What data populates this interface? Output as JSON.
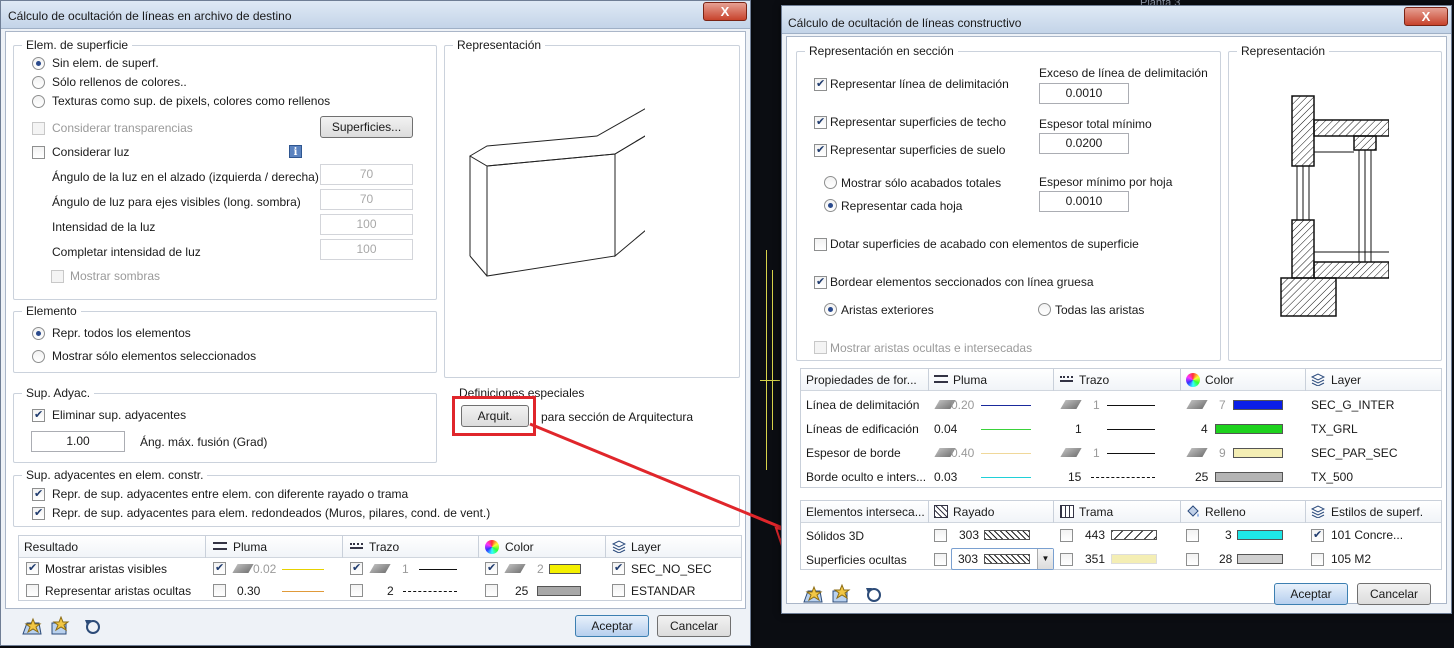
{
  "background": {
    "texts": [
      "Planta 3"
    ],
    "colors": {
      "accent_line": "#d6d24a"
    }
  },
  "left_dialog": {
    "title": "Cálculo de ocultación de líneas en archivo de destino",
    "close_label": "X",
    "surface": {
      "group_title": "Elem. de superficie",
      "radios": [
        {
          "label": "Sin elem. de superf.",
          "checked": true
        },
        {
          "label": "Sólo rellenos de colores..",
          "checked": false
        },
        {
          "label": "Texturas como sup. de pixels, colores como rellenos",
          "checked": false
        }
      ],
      "transparencias": "Considerar transparencias",
      "superficies_btn": "Superficies...",
      "considerar_luz": "Considerar luz",
      "light_rows": [
        {
          "label": "Ángulo de la luz en el alzado (izquierda / derecha)",
          "value": "70"
        },
        {
          "label": "Ángulo de luz para ejes visibles (long. sombra)",
          "value": "70"
        },
        {
          "label": "Intensidad de la luz",
          "value": "100"
        },
        {
          "label": "Completar intensidad de luz",
          "value": "100"
        }
      ],
      "sombras": "Mostrar sombras"
    },
    "representacion_title": "Representación",
    "elemento": {
      "group_title": "Elemento",
      "radios": [
        {
          "label": "Repr. todos los elementos",
          "checked": true
        },
        {
          "label": "Mostrar sólo elementos seleccionados",
          "checked": false
        }
      ]
    },
    "sup_adyac": {
      "group_title": "Sup. Adyac.",
      "eliminar": "Eliminar sup. adyacentes",
      "value": "1.00",
      "angle_label": "Áng. máx. fusión (Grad)"
    },
    "definiciones": {
      "group_title": "Definiciones especiales",
      "arquit_btn": "Arquit.",
      "arquit_desc": "para sección de Arquitectura"
    },
    "sup_constr": {
      "group_title": "Sup. adyacentes en elem. constr.",
      "opt1": "Repr. de sup. adyacentes entre elem. con diferente rayado o trama",
      "opt2": "Repr. de sup. adyacentes para elem. redondeados (Muros, pilares, cond. de vent.)"
    },
    "result_table": {
      "headers": [
        "Resultado",
        "Pluma",
        "Trazo",
        "Color",
        "Layer"
      ],
      "rows": [
        {
          "label": "Mostrar aristas visibles",
          "pluma": "0.02",
          "trazo": "1",
          "color": "2",
          "layer": "SEC_NO_SEC",
          "color_hex": "#f4f000",
          "pen_line": "#e6d100"
        },
        {
          "label": "Representar aristas ocultas",
          "pluma": "0.30",
          "trazo": "2",
          "color": "25",
          "layer": "ESTANDAR",
          "color_hex": "#a8a8a8",
          "pen_line": "#e09a3a"
        }
      ]
    },
    "footer": {
      "aceptar": "Aceptar",
      "cancelar": "Cancelar"
    }
  },
  "right_dialog": {
    "title": "Cálculo de ocultación de líneas constructivo",
    "close_label": "X",
    "seccion": {
      "group_title": "Representación en sección",
      "linea_delim": "Representar línea de delimitación",
      "exceso_label": "Exceso de línea de delimitación",
      "exceso_value": "0.0010",
      "techo": "Representar superficies de techo",
      "espesor_total_label": "Espesor total mínimo",
      "espesor_total_value": "0.0200",
      "suelo": "Representar superficies de suelo",
      "acabados": "Mostrar sólo acabados totales",
      "espesor_hoja_label": "Espesor mínimo por hoja",
      "cada_hoja": "Representar cada hoja",
      "espesor_hoja_value": "0.0010",
      "dotar": "Dotar superficies de acabado con elementos de superficie",
      "bordear": "Bordear elementos seccionados con línea gruesa",
      "aristas_ext": "Aristas exteriores",
      "todas_aristas": "Todas las aristas",
      "ocultas": "Mostrar aristas ocultas e intersecadas"
    },
    "representacion_title": "Representación",
    "props_table": {
      "headers": [
        "Propiedades de for...",
        "Pluma",
        "Trazo",
        "Color",
        "Layer"
      ],
      "rows": [
        {
          "label": "Línea de delimitación",
          "pluma": "0.20",
          "trazo": "1",
          "color": "7",
          "layer": "SEC_G_INTER",
          "color_hex": "#0a1ee6",
          "pen_line": "#1a2a9c",
          "inherit": true
        },
        {
          "label": "Líneas de edificación",
          "pluma": "0.04",
          "trazo": "1",
          "color": "4",
          "layer": "TX_GRL",
          "color_hex": "#1ed21e",
          "pen_line": "#3ad23a",
          "inherit": false
        },
        {
          "label": "Espesor de borde",
          "pluma": "0.40",
          "trazo": "1",
          "color": "9",
          "layer": "SEC_PAR_SEC",
          "color_hex": "#f4eeb4",
          "pen_line": "#f0d89a",
          "inherit": true
        },
        {
          "label": "Borde oculto e inters...",
          "pluma": "0.03",
          "trazo": "15",
          "color": "25",
          "layer": "TX_500",
          "color_hex": "#b4b4b4",
          "pen_line": "#20d0d8",
          "inherit": false
        }
      ]
    },
    "inter_table": {
      "headers": [
        "Elementos interseca...",
        "Rayado",
        "Trama",
        "Relleno",
        "Estilos de superf."
      ],
      "rows": [
        {
          "label": "Sólidos 3D",
          "rayado": "303",
          "trama": "443",
          "relleno": "3",
          "estilo": "101 Concre...",
          "relleno_hex": "#1ee6e6",
          "estilo_checked": true
        },
        {
          "label": "Superficies ocultas",
          "rayado": "303",
          "trama": "351",
          "relleno": "28",
          "estilo": "105 M2",
          "relleno_hex": "#d0d0d0",
          "estilo_checked": false
        }
      ]
    },
    "footer": {
      "aceptar": "Aceptar",
      "cancelar": "Cancelar"
    }
  }
}
